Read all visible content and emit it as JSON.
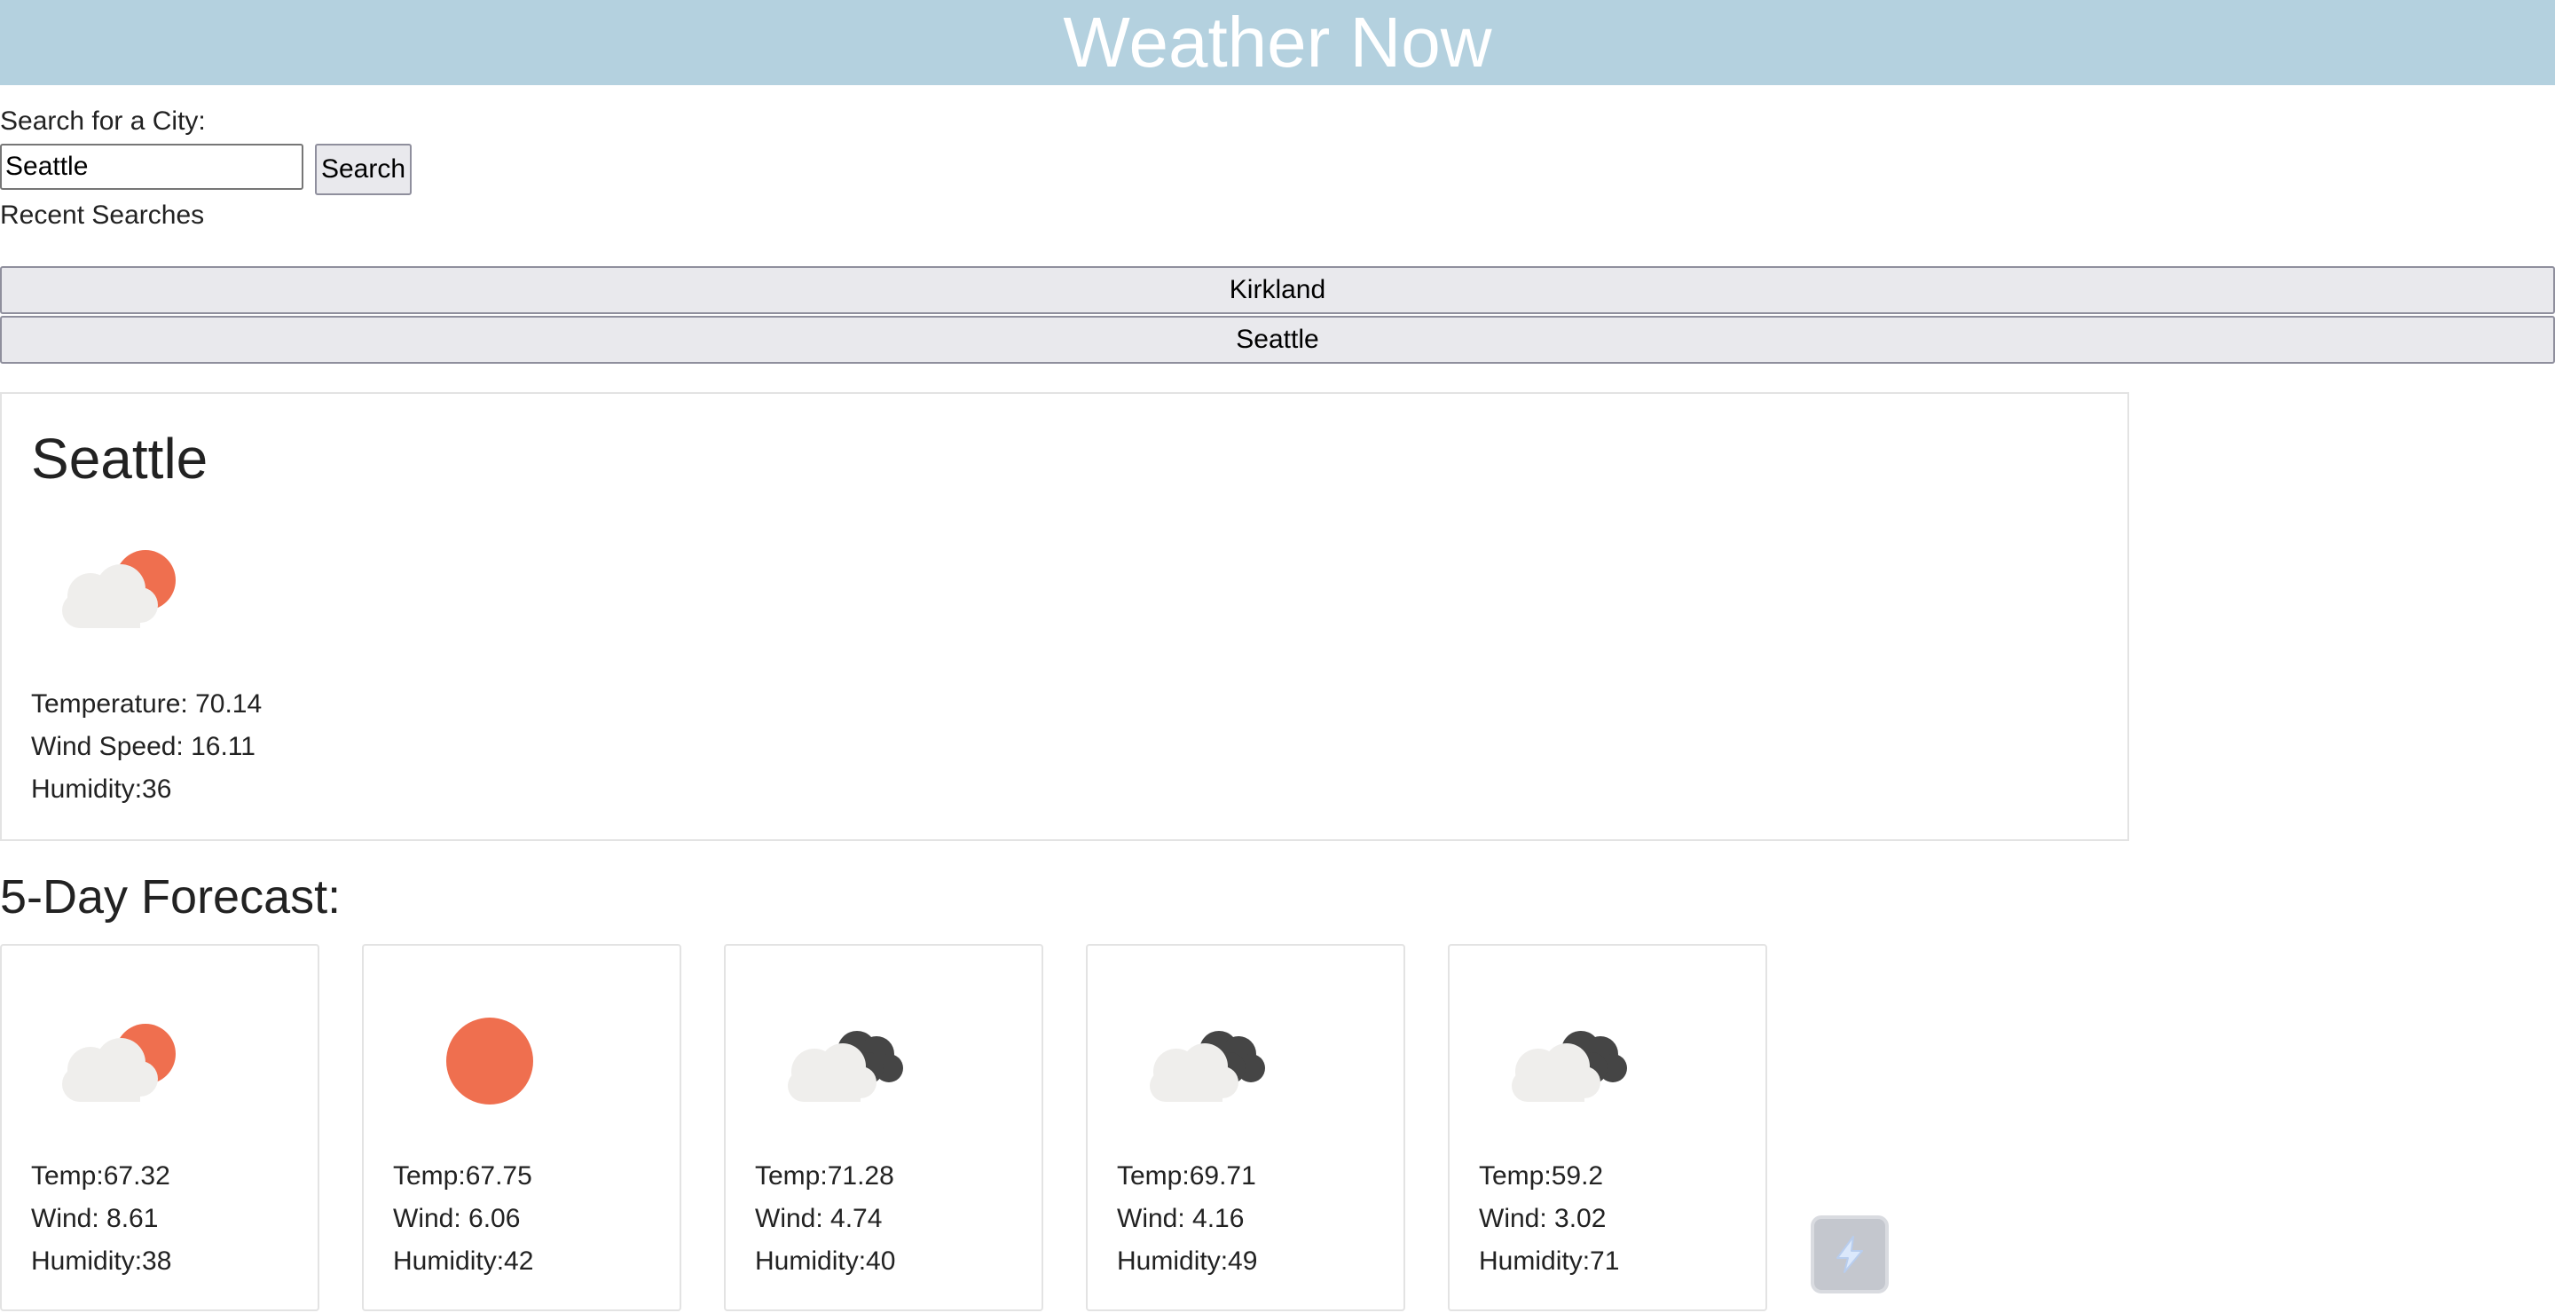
{
  "header": {
    "title": "Weather Now"
  },
  "search": {
    "label": "Search for a City:",
    "value": "Seattle",
    "button_label": "Search",
    "recent_label": "Recent Searches"
  },
  "recent_searches": [
    "Kirkland",
    "Seattle"
  ],
  "current": {
    "city": "Seattle",
    "icon": "partly-cloudy-day-icon",
    "temperature_text": "Temperature: 70.14",
    "wind_text": "Wind Speed: 16.11",
    "humidity_text": "Humidity:36"
  },
  "forecast": {
    "title": "5-Day Forecast:",
    "days": [
      {
        "icon": "partly-cloudy-day-icon",
        "temp": "Temp:67.32",
        "wind": "Wind: 8.61",
        "humidity": "Humidity:38"
      },
      {
        "icon": "clear-sun-icon",
        "temp": "Temp:67.75",
        "wind": "Wind: 6.06",
        "humidity": "Humidity:42"
      },
      {
        "icon": "broken-clouds-icon",
        "temp": "Temp:71.28",
        "wind": "Wind: 4.74",
        "humidity": "Humidity:40"
      },
      {
        "icon": "broken-clouds-icon",
        "temp": "Temp:69.71",
        "wind": "Wind: 4.16",
        "humidity": "Humidity:49"
      },
      {
        "icon": "broken-clouds-icon",
        "temp": "Temp:59.2",
        "wind": "Wind: 3.02",
        "humidity": "Humidity:71"
      }
    ]
  },
  "colors": {
    "banner": "#b4d1df",
    "sun": "#ef6f4f",
    "cloud_light": "#efeeec",
    "cloud_dark": "#454545"
  }
}
